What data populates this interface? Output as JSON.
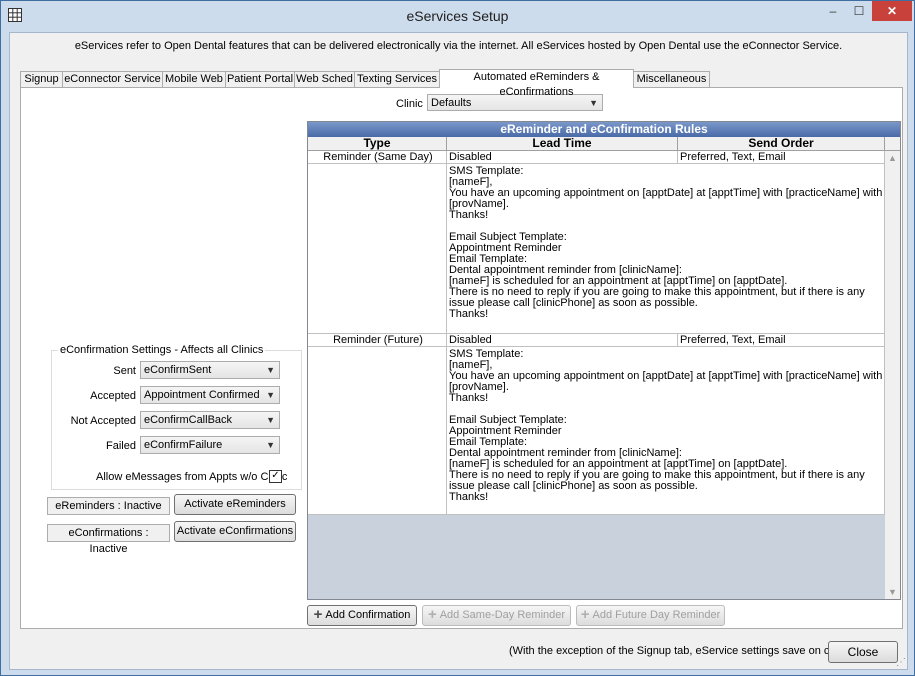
{
  "window": {
    "title": "eServices Setup",
    "minimize": "–",
    "maximize": "☐",
    "close": "✕"
  },
  "intro": "eServices refer to Open Dental features that can be delivered electronically via the internet.  All eServices hosted by Open Dental use the eConnector Service.",
  "tabs": [
    "Signup",
    "eConnector Service",
    "Mobile Web",
    "Patient Portal",
    "Web Sched",
    "Texting Services",
    "Automated eReminders & eConfirmations",
    "Miscellaneous"
  ],
  "active_tab": "Automated eReminders & eConfirmations",
  "clinic": {
    "label": "Clinic",
    "value": "Defaults"
  },
  "grid": {
    "title": "eReminder and eConfirmation Rules",
    "headers": [
      "Type",
      "Lead Time",
      "Send Order"
    ],
    "rows": [
      {
        "type": "Reminder (Same Day)",
        "lead_time": "Disabled",
        "send_order": "Preferred, Text, Email",
        "note": "SMS Template:\n[nameF],\nYou have an upcoming appointment on [apptDate] at [apptTime] with [practiceName] with\n[provName].\nThanks!\n\nEmail Subject Template:\nAppointment Reminder\nEmail Template:\nDental appointment reminder from [clinicName]:\n[nameF] is scheduled for an appointment at [apptTime] on [apptDate].\nThere is no need to reply if you are going to make this appointment, but if there is any\nissue please call [clinicPhone] as soon as possible.\nThanks!"
      },
      {
        "type": "Reminder (Future)",
        "lead_time": "Disabled",
        "send_order": "Preferred, Text, Email",
        "note": "SMS Template:\n[nameF],\nYou have an upcoming appointment on [apptDate] at [apptTime] with [practiceName] with\n[provName].\nThanks!\n\nEmail Subject Template:\nAppointment Reminder\nEmail Template:\nDental appointment reminder from [clinicName]:\n[nameF] is scheduled for an appointment at [apptTime] on [apptDate].\nThere is no need to reply if you are going to make this appointment, but if there is any\nissue please call [clinicPhone] as soon as possible.\nThanks!"
      }
    ]
  },
  "confirmation_settings": {
    "legend": "eConfirmation Settings - Affects all Clinics",
    "fields": [
      {
        "label": "Sent",
        "value": "eConfirmSent"
      },
      {
        "label": "Accepted",
        "value": "Appointment Confirmed"
      },
      {
        "label": "Not Accepted",
        "value": "eConfirmCallBack"
      },
      {
        "label": "Failed",
        "value": "eConfirmFailure"
      }
    ],
    "allow_label": "Allow eMessages from Appts w/o Clinic",
    "allow_checked": "✓"
  },
  "status": {
    "reminders": "eReminders : Inactive",
    "reminders_button": "Activate eReminders",
    "confirmations": "eConfirmations : Inactive",
    "confirmations_button": "Activate eConfirmations"
  },
  "buttons": {
    "add_confirmation": "Add Confirmation",
    "add_same_day": "Add Same-Day Reminder",
    "add_future": "Add Future Day Reminder",
    "close": "Close"
  },
  "save_note": "(With the exception of the Signup tab, eService settings save on close)"
}
